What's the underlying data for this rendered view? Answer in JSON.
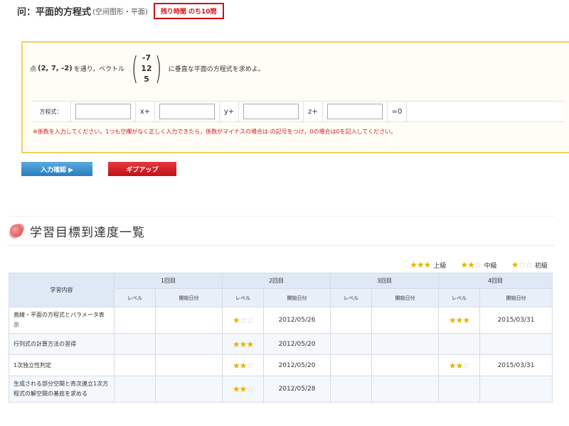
{
  "question": {
    "title": "问：平面的方程式",
    "title_note": "(空间图形・平面)",
    "remaining_badge": "残り時間 のち10問",
    "statement_prefix": "点",
    "point": "(2, 7, -2)",
    "statement_mid": "を通り，ベクトル",
    "vector": [
      "-7",
      "12",
      "5"
    ],
    "statement_suffix": "に垂直な平面の方程式を求めよ。",
    "answer_label": "方程式：",
    "separators": [
      "x+",
      "y+",
      "z+",
      "=0"
    ],
    "inputs": [
      "",
      "",
      "",
      ""
    ],
    "note": "※係数を入力してください。1つも空欄がなく正しく入力できたら，係数がマイナスの場合は-の記号をつけ，0の場合は0を記入してください。",
    "submit_button": "入力確認 ▶",
    "giveup_button": "ギブアップ"
  },
  "section": {
    "title": "学習目標到達度一覧",
    "icon": "flower-icon"
  },
  "legend": [
    {
      "stars": "★★★",
      "label": "上級"
    },
    {
      "stars": "★★☆",
      "label": "中級"
    },
    {
      "stars": "★☆☆",
      "label": "初級"
    }
  ],
  "table": {
    "content_header": "学習内容",
    "rounds": [
      "1回目",
      "2回目",
      "3回目",
      "4回目"
    ],
    "sub_headers": [
      "レベル",
      "開始日付"
    ],
    "rows": [
      {
        "content": "直線・平面の方程式とパラメータ表示",
        "cells": [
          [
            "",
            ""
          ],
          [
            "★☆☆",
            "2012/05/26"
          ],
          [
            "",
            ""
          ],
          [
            "★★★",
            "2015/03/31"
          ]
        ]
      },
      {
        "content": "行列式の計算方法の習得",
        "cells": [
          [
            "",
            ""
          ],
          [
            "★★★",
            "2012/05/20"
          ],
          [
            "",
            ""
          ],
          [
            "",
            ""
          ]
        ]
      },
      {
        "content": "1次独立性判定",
        "cells": [
          [
            "",
            ""
          ],
          [
            "★★☆",
            "2012/05/20"
          ],
          [
            "",
            ""
          ],
          [
            "★★☆",
            "2015/03/31"
          ]
        ]
      },
      {
        "content": "生成される部分空間と斉次連立1次方程式の解空間の基底を求める",
        "cells": [
          [
            "",
            ""
          ],
          [
            "★★☆",
            "2012/05/28"
          ],
          [
            "",
            ""
          ],
          [
            "",
            ""
          ]
        ]
      }
    ]
  },
  "colors": {
    "accent_red": "#d01010",
    "button_blue": "#2a7fbf",
    "panel_border": "#f3cf5d",
    "star": "#e6b400",
    "table_header": "#dfe9f6"
  }
}
